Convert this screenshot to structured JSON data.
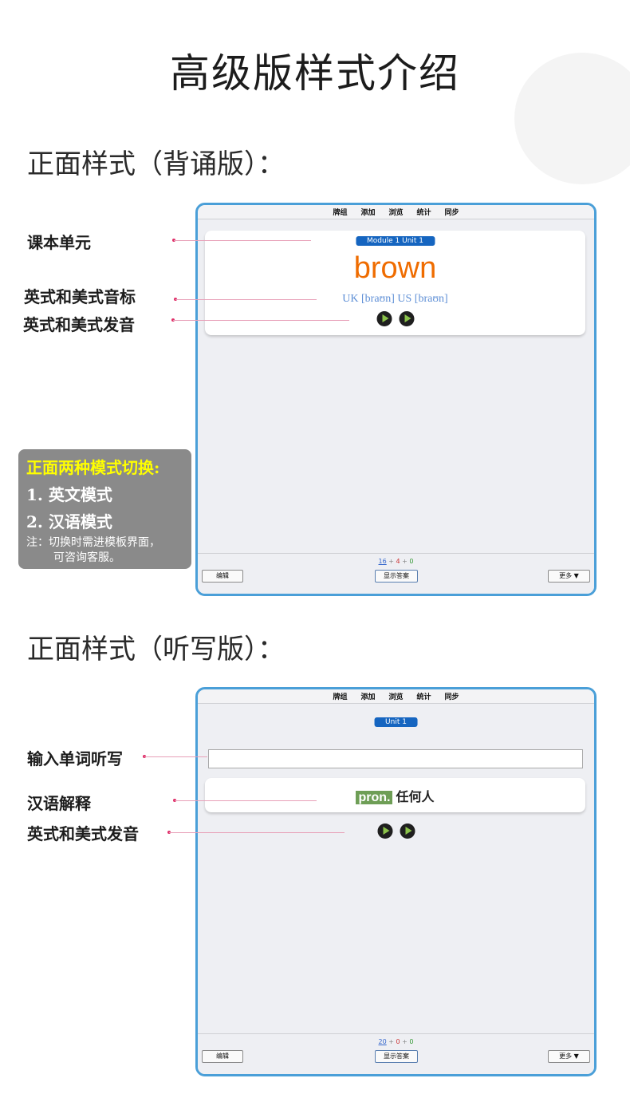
{
  "page": {
    "title": "高级版样式介绍",
    "section1_title": "正面样式（背诵版）：",
    "section2_title": "正面样式（听写版）："
  },
  "menu": [
    "牌组",
    "添加",
    "浏览",
    "统计",
    "同步"
  ],
  "window1": {
    "tag": "Module 1 Unit 1",
    "word": "brown",
    "phonetic": "UK [braʊn] US [braʊn]",
    "counts": {
      "new": "16",
      "learn": "4",
      "due": "0",
      "sep": "+"
    },
    "buttons": {
      "edit": "编辑",
      "show": "显示答案",
      "more": "更多 ▼"
    }
  },
  "window2": {
    "tag": "Unit 1",
    "pos": "pron.",
    "meaning": "任何人",
    "counts": {
      "new": "20",
      "learn": "0",
      "due": "0",
      "sep": "+"
    },
    "buttons": {
      "edit": "编辑",
      "show": "显示答案",
      "more": "更多 ▼"
    }
  },
  "callouts1": {
    "unit": "课本单元",
    "phonetic": "英式和美式音标",
    "audio": "英式和美式发音"
  },
  "note": {
    "title": "正面两种模式切换:",
    "item1": "1. 英文模式",
    "item2": "2. 汉语模式",
    "line1": "注：切换时需进模板界面，",
    "line2": "可咨询客服。"
  },
  "callouts2": {
    "input": "输入单词听写",
    "meaning": "汉语解释",
    "audio": "英式和美式发音"
  },
  "colors": {
    "window_border": "#4a9fd8",
    "tag_bg": "#1565c0",
    "word": "#ef6c00",
    "phonetic": "#5e8fd6",
    "pos_bg": "#6e9e56",
    "note_bg": "#8a8a8a",
    "note_title": "#ffff00",
    "leader_dot": "#e0306a"
  }
}
